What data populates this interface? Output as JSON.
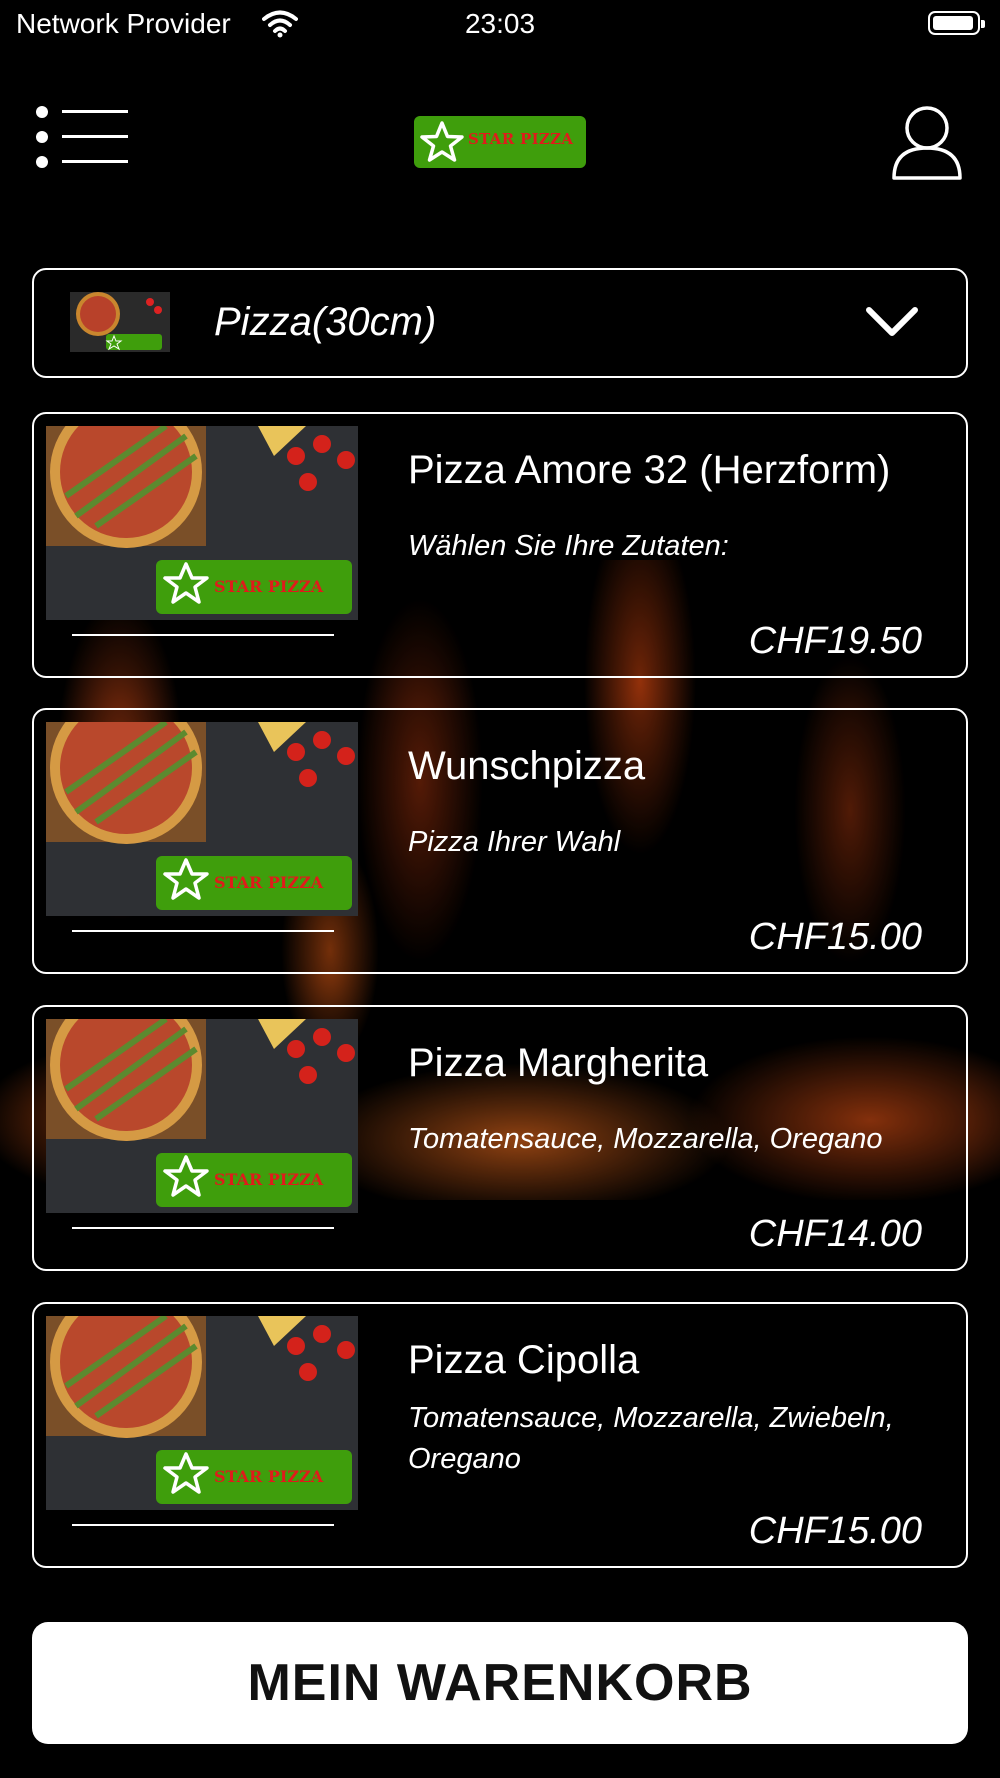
{
  "status_bar": {
    "provider": "Network Provider",
    "time": "23:03",
    "battery_level": 0.95
  },
  "header": {
    "logo_text": "STAR PIZZA",
    "icons": {
      "menu": "menu-list-icon",
      "user": "user-icon"
    }
  },
  "category": {
    "selected": "Pizza(30cm)",
    "icon": "chevron-down-icon"
  },
  "products": [
    {
      "name": "Pizza Amore 32 (Herzform)",
      "description": "Wählen Sie Ihre Zutaten:",
      "price": "CHF19.50"
    },
    {
      "name": "Wunschpizza",
      "description": "Pizza Ihrer Wahl",
      "price": "CHF15.00"
    },
    {
      "name": "Pizza Margherita",
      "description": "Tomatensauce, Mozzarella, Oregano",
      "price": "CHF14.00"
    },
    {
      "name": "Pizza Cipolla",
      "description": "Tomatensauce, Mozzarella, Zwiebeln, Oregano",
      "price": "CHF15.00"
    }
  ],
  "cart": {
    "label": "MEIN WARENKORB"
  },
  "colors": {
    "background": "#000000",
    "brand_green": "#3f9e0c",
    "logo_red": "#e01b1b",
    "text": "#ffffff"
  }
}
